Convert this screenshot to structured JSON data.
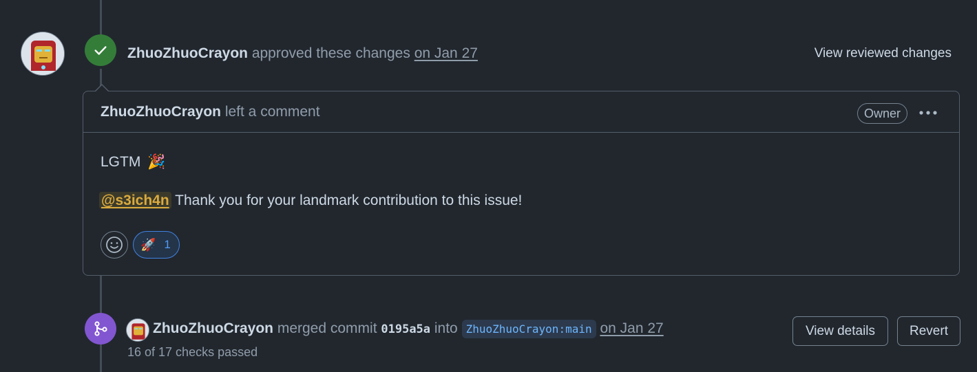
{
  "approval_event": {
    "author": "ZhuoZhuoCrayon",
    "action": "approved these changes",
    "date": "on Jan 27",
    "view_reviewed_label": "View reviewed changes",
    "icon": "check-icon",
    "badge_color": "#347d39"
  },
  "comment": {
    "author": "ZhuoZhuoCrayon",
    "action": "left a comment",
    "role_badge": "Owner",
    "menu_icon": "kebab-horizontal-icon",
    "body_line1": "LGTM",
    "body_line1_emoji": "🎉",
    "mention": "@s3ich4n",
    "body_line2": " Thank you for your landmark contribution to this issue!",
    "add_reaction_icon": "smiley-icon",
    "reactions": [
      {
        "emoji": "🚀",
        "count": "1",
        "icon": "rocket-icon"
      }
    ]
  },
  "merge_event": {
    "author": "ZhuoZhuoCrayon",
    "action": "merged commit",
    "commit_sha": "0195a5a",
    "into_text": "into",
    "branch": "ZhuoZhuoCrayon:main",
    "date": "on Jan 27",
    "checks_text": "16 of 17 checks passed",
    "view_details_label": "View details",
    "revert_label": "Revert",
    "icon": "git-merge-icon",
    "badge_color": "#8256d0"
  },
  "colors": {
    "background": "#22272e",
    "border": "#545d68",
    "mention_text": "#daaa3f",
    "link_blue": "#539bf5"
  }
}
